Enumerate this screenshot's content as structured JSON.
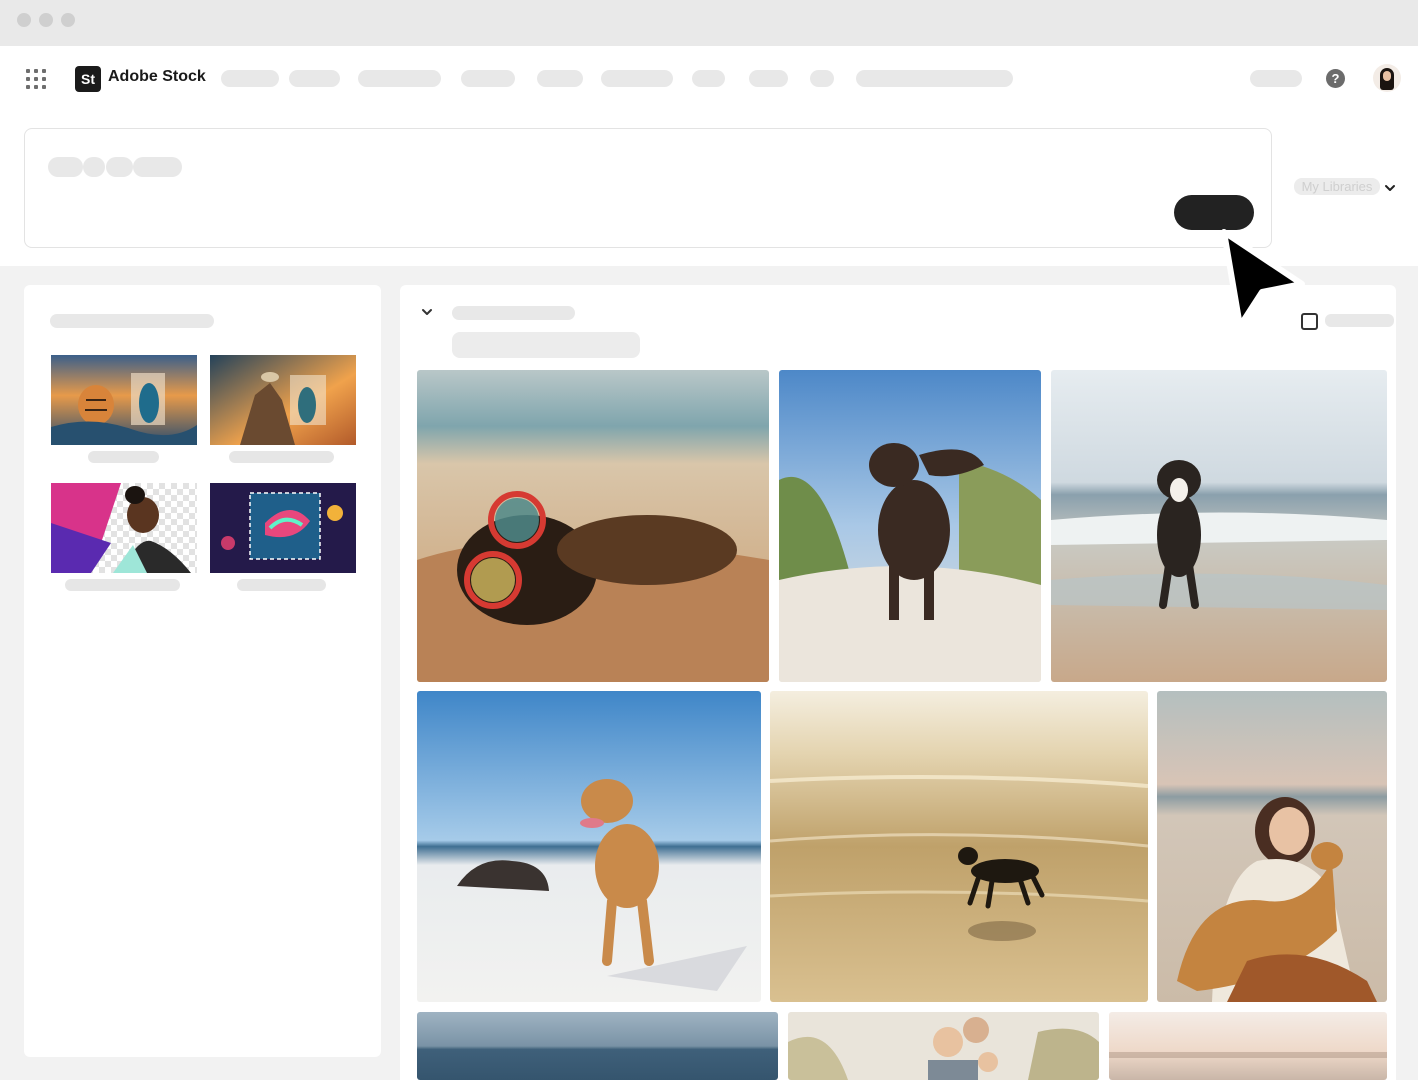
{
  "app": {
    "brand_mark": "St",
    "brand_name": "Adobe Stock",
    "help_glyph": "?"
  },
  "header": {
    "apps_icon": "grid-icon",
    "help_icon": "help-icon",
    "avatar": "user-avatar"
  },
  "prompt": {
    "library_selector": "My Libraries"
  },
  "icons": {
    "collapse": "chevron-down-icon",
    "checkbox": "checkbox-icon",
    "cursor": "cursor-arrow-icon"
  },
  "colors": {
    "accent": "#222222",
    "skeleton": "#e8e8e8",
    "panel_bg": "#f2f2f2"
  },
  "left_panel": {
    "thumbnails": [
      {
        "subject": "tiger and peacock in surreal sunset"
      },
      {
        "subject": "peacock on rock island at sunset"
      },
      {
        "subject": "woman portrait with transparent background"
      },
      {
        "subject": "colorful betta fish with selection box"
      }
    ]
  },
  "gallery": {
    "photos": [
      {
        "subject": "dachshund wearing red sunglasses on sand"
      },
      {
        "subject": "wet brown spaniel in dune grass"
      },
      {
        "subject": "tricolor dog running on beach"
      },
      {
        "subject": "yellow labrador standing on white sand beach"
      },
      {
        "subject": "dog silhouette running in surf at sunset"
      },
      {
        "subject": "woman hugging corgi on beach"
      },
      {
        "subject": "sea horizon"
      },
      {
        "subject": "father and sons in dunes"
      },
      {
        "subject": "blurred pier at dusk"
      }
    ]
  }
}
